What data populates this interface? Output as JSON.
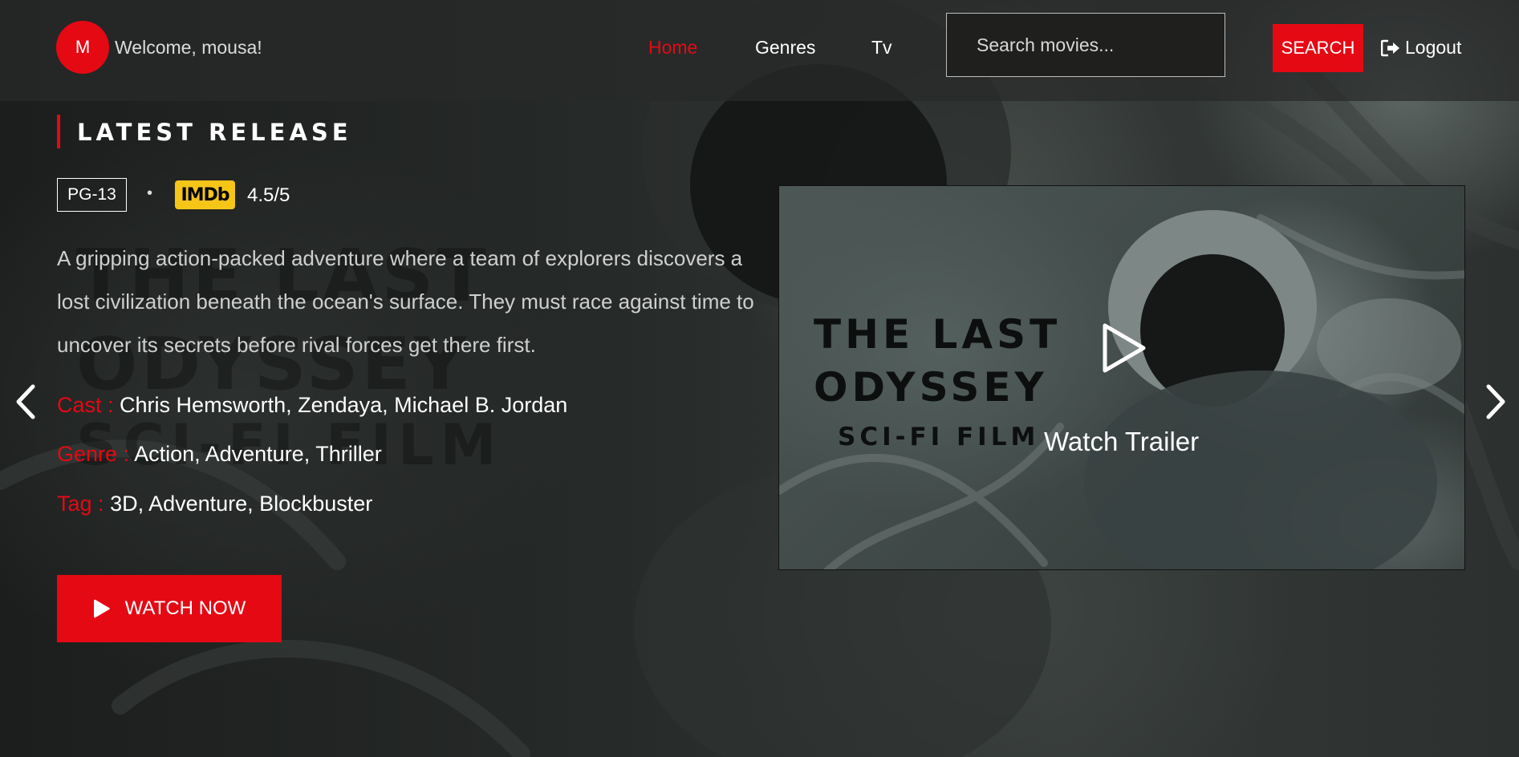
{
  "header": {
    "avatar_initial": "M",
    "welcome": "Welcome, mousa!",
    "nav": {
      "home": "Home",
      "genres": "Genres",
      "tv": "Tv"
    },
    "search_placeholder": "Search movies...",
    "search_label": "SEARCH",
    "logout_label": "Logout"
  },
  "hero": {
    "section_title": "LATEST RELEASE",
    "rating": "PG-13",
    "separator": "•",
    "imdb_label": "IMDb",
    "imdb_score": "4.5/5",
    "description": "A gripping action-packed adventure where a team of explorers discovers a lost civilization beneath the ocean's surface. They must race against time to uncover its secrets before rival forces get there first.",
    "cast_label": "Cast :",
    "cast": "Chris Hemsworth, Zendaya, Michael B. Jordan",
    "genre_label": "Genre :",
    "genre": "Action, Adventure, Thriller",
    "tag_label": "Tag :",
    "tag": "3D, Adventure, Blockbuster",
    "watch_now": "WATCH NOW",
    "watch_trailer": "Watch Trailer"
  },
  "poster": {
    "line1": "THE LAST",
    "line2": "ODYSSEY",
    "line3": "SCI-FI FILM"
  },
  "icons": {
    "logout": "sign-out-icon",
    "play": "play-icon",
    "prev": "chevron-left-icon",
    "next": "chevron-right-icon"
  },
  "colors": {
    "accent": "#e50914",
    "imdb": "#f5c518"
  }
}
